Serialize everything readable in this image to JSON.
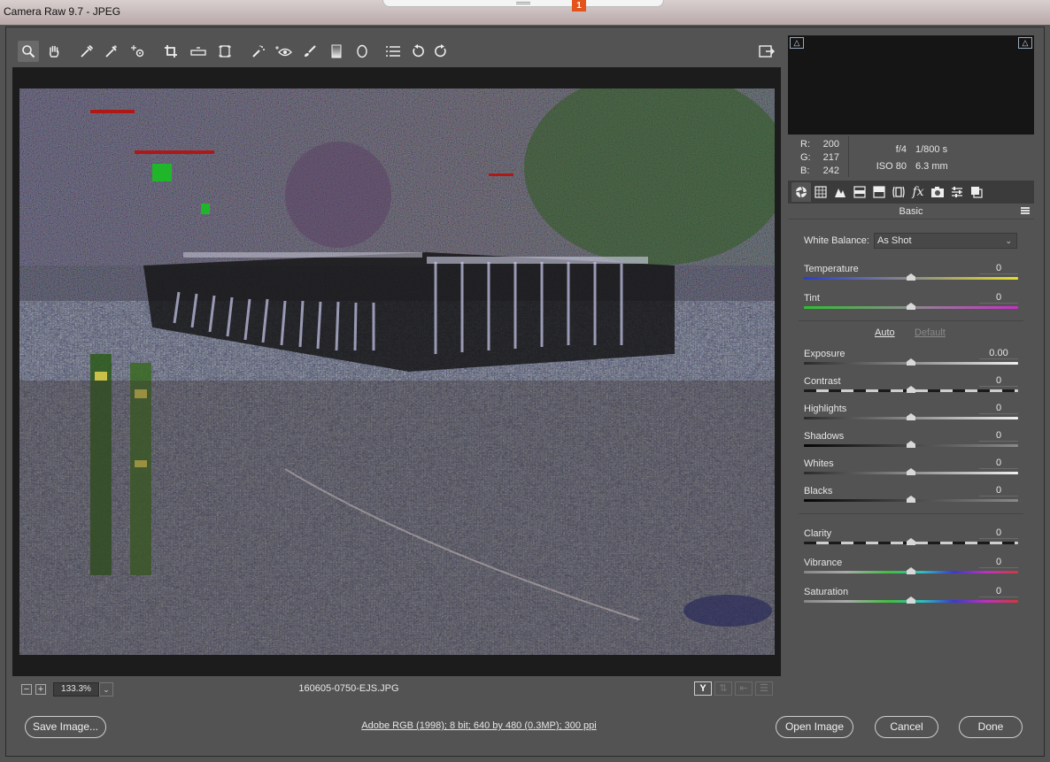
{
  "window": {
    "title": "Camera Raw 9.7  -  JPEG",
    "notification_count": "1"
  },
  "toolbar": {
    "tools": [
      {
        "name": "zoom-tool",
        "icon": "magnifier-icon",
        "active": true
      },
      {
        "name": "hand-tool",
        "icon": "hand-icon"
      },
      {
        "name": "white-balance-tool",
        "icon": "eyedropper-icon"
      },
      {
        "name": "color-sampler-tool",
        "icon": "color-sampler-icon"
      },
      {
        "name": "targeted-adjustment-tool",
        "icon": "target-adjust-icon"
      },
      {
        "name": "crop-tool",
        "icon": "crop-icon"
      },
      {
        "name": "straighten-tool",
        "icon": "level-icon"
      },
      {
        "name": "transform-tool",
        "icon": "transform-icon"
      },
      {
        "name": "spot-removal-tool",
        "icon": "spot-brush-icon"
      },
      {
        "name": "red-eye-tool",
        "icon": "eye-icon"
      },
      {
        "name": "adjustment-brush-tool",
        "icon": "brush-icon"
      },
      {
        "name": "graduated-filter-tool",
        "icon": "gradient-icon"
      },
      {
        "name": "radial-filter-tool",
        "icon": "ellipse-icon"
      },
      {
        "name": "preferences-tool",
        "icon": "list-icon"
      },
      {
        "name": "rotate-left-tool",
        "icon": "rotate-ccw-icon"
      },
      {
        "name": "rotate-right-tool",
        "icon": "rotate-cw-icon"
      }
    ],
    "fullscreen_icon": "fullscreen-toggle-icon"
  },
  "canvas": {
    "zoom": "133.3%",
    "filename": "160605-0750-EJS.JPG",
    "view_buttons": [
      "Y",
      "",
      "",
      ""
    ]
  },
  "readout": {
    "r_label": "R:",
    "r_value": "200",
    "g_label": "G:",
    "g_value": "217",
    "b_label": "B:",
    "b_value": "242",
    "aperture": "f/4",
    "shutter": "1/800 s",
    "iso": "ISO 80",
    "focal": "6.3 mm"
  },
  "panel": {
    "title": "Basic",
    "tabs": [
      "basic-tab-icon",
      "tone-curve-icon",
      "detail-icon",
      "hsl-icon",
      "split-toning-icon",
      "lens-icon",
      "effects-icon",
      "camera-calibration-icon",
      "presets-icon",
      "snapshots-icon"
    ]
  },
  "basic": {
    "white_balance_label": "White Balance:",
    "white_balance_value": "As Shot",
    "auto": "Auto",
    "default": "Default",
    "sliders": [
      {
        "label": "Temperature",
        "value": "0",
        "position": 0.5,
        "track": "temp"
      },
      {
        "label": "Tint",
        "value": "0",
        "position": 0.5,
        "track": "tint"
      },
      {
        "label": "Exposure",
        "value": "0.00",
        "position": 0.5,
        "track": "gray"
      },
      {
        "label": "Contrast",
        "value": "0",
        "position": 0.5,
        "track": "dash"
      },
      {
        "label": "Highlights",
        "value": "0",
        "position": 0.5,
        "track": "light"
      },
      {
        "label": "Shadows",
        "value": "0",
        "position": 0.5,
        "track": "dark"
      },
      {
        "label": "Whites",
        "value": "0",
        "position": 0.5,
        "track": "light"
      },
      {
        "label": "Blacks",
        "value": "0",
        "position": 0.5,
        "track": "dark"
      },
      {
        "label": "Clarity",
        "value": "0",
        "position": 0.5,
        "track": "dash"
      },
      {
        "label": "Vibrance",
        "value": "0",
        "position": 0.5,
        "track": "rainbow"
      },
      {
        "label": "Saturation",
        "value": "0",
        "position": 0.5,
        "track": "rainbow"
      }
    ]
  },
  "footer": {
    "save": "Save Image...",
    "info": "Adobe RGB (1998); 8 bit; 640 by 480 (0.3MP); 300 ppi",
    "open": "Open Image",
    "cancel": "Cancel",
    "done": "Done"
  }
}
